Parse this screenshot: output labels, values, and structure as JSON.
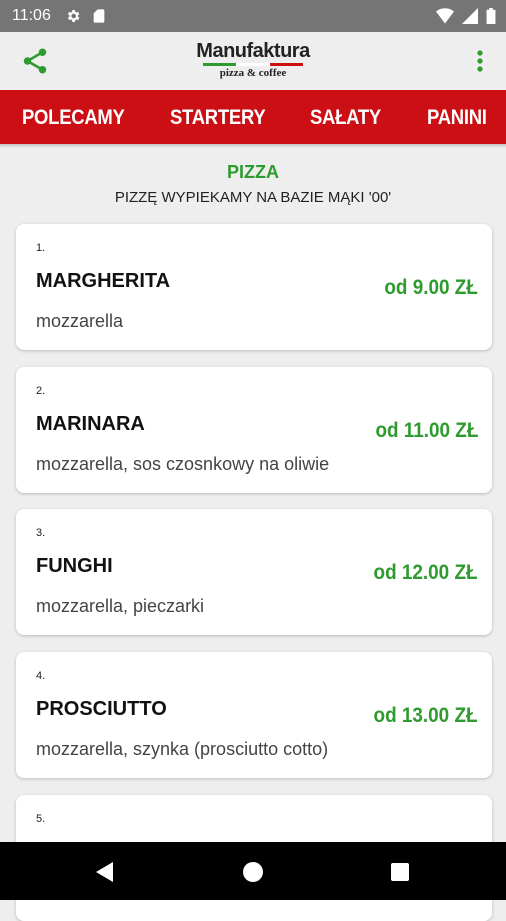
{
  "status_bar": {
    "time": "11:06",
    "icons": [
      "gear-icon",
      "sd-card-icon",
      "wifi-icon",
      "signal-icon",
      "battery-icon"
    ]
  },
  "app_bar": {
    "logo_title": "Manufaktura",
    "logo_subtitle": "pizza & coffee",
    "share_icon": "share-icon",
    "menu_icon": "more-vertical-icon"
  },
  "tabs": [
    "POLECAMY",
    "STARTERY",
    "SAŁATY",
    "PANINI"
  ],
  "section": {
    "title": "PIZZA",
    "subtitle": "PIZZĘ WYPIEKAMY NA BAZIE MĄKI '00'"
  },
  "items": [
    {
      "number": "1.",
      "name": "MARGHERITA",
      "price": "od 9.00 ZŁ",
      "description": "mozzarella"
    },
    {
      "number": "2.",
      "name": "MARINARA",
      "price": "od 11.00 ZŁ",
      "description": "mozzarella, sos czosnkowy na oliwie"
    },
    {
      "number": "3.",
      "name": "FUNGHI",
      "price": "od 12.00 ZŁ",
      "description": "mozzarella, pieczarki"
    },
    {
      "number": "4.",
      "name": "PROSCIUTTO",
      "price": "od 13.00 ZŁ",
      "description": "mozzarella, szynka (prosciutto cotto)"
    },
    {
      "number": "5.",
      "name": "",
      "price": "",
      "description": ""
    }
  ],
  "colors": {
    "accent_red": "#cc0f14",
    "price_green": "#2e9b2e",
    "background": "#eeeeee"
  }
}
